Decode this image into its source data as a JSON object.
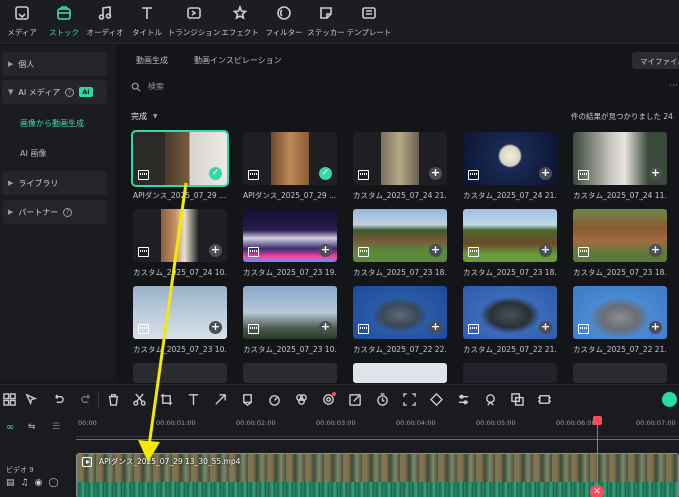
{
  "toolbar": {
    "items": [
      {
        "label": "メディア",
        "icon": "media-icon"
      },
      {
        "label": "ストック",
        "icon": "stock-icon",
        "active": true
      },
      {
        "label": "オーディオ",
        "icon": "music-icon"
      },
      {
        "label": "タイトル",
        "icon": "title-icon"
      },
      {
        "label": "トランジション",
        "icon": "transition-icon"
      },
      {
        "label": "エフェクト",
        "icon": "effect-icon"
      },
      {
        "label": "フィルター",
        "icon": "filter-icon"
      },
      {
        "label": "ステッカー",
        "icon": "sticker-icon"
      },
      {
        "label": "テンプレート",
        "icon": "template-icon"
      }
    ]
  },
  "sidebar": {
    "personal": "個人",
    "ai_media": "AI メディア",
    "ai_badge": "AI",
    "image_to_video": "画像から動画生成",
    "ai_image": "AI 画像",
    "library": "ライブラリ",
    "partner": "パートナー"
  },
  "content": {
    "tabs": [
      "動画生成",
      "動画インスピレーション"
    ],
    "my_files": "マイファイル",
    "search_placeholder": "検索",
    "filter_label": "完成",
    "result_text": "件の結果が見つかりました 24",
    "cards": [
      {
        "name": "APIダンス_2025_07_29 ...",
        "status": "done",
        "selected": true
      },
      {
        "name": "APIダンス_2025_07_29 ...",
        "status": "done"
      },
      {
        "name": "カスタム_2025_07_24 21...",
        "status": "add"
      },
      {
        "name": "カスタム_2025_07_24 21...",
        "status": "add"
      },
      {
        "name": "カスタム_2025_07_24 11...",
        "status": "add"
      },
      {
        "name": "カスタム_2025_07_24 10...",
        "status": "add"
      },
      {
        "name": "カスタム_2025_07_23 19...",
        "status": "add"
      },
      {
        "name": "カスタム_2025_07_23 18...",
        "status": "add"
      },
      {
        "name": "カスタム_2025_07_23 18...",
        "status": "add"
      },
      {
        "name": "カスタム_2025_07_23 18...",
        "status": "add"
      },
      {
        "name": "カスタム_2025_07_23 10...",
        "status": "add"
      },
      {
        "name": "カスタム_2025_07_23 10...",
        "status": "add"
      },
      {
        "name": "カスタム_2025_07_22 22...",
        "status": "add"
      },
      {
        "name": "カスタム_2025_07_22 21...",
        "status": "add"
      },
      {
        "name": "カスタム_2025_07_22 21...",
        "status": "add"
      }
    ]
  },
  "timeline": {
    "ticks": [
      "00:00",
      "00:00:01:00",
      "00:00:02:00",
      "00:00:03:00",
      "00:00:04:00",
      "00:00:05:00",
      "00:00:06:00",
      "00:00:07:00"
    ],
    "track_label": "ビデオ 9",
    "clip_title": "APIダンス_2025_07_29 13_30_55.mp4"
  }
}
